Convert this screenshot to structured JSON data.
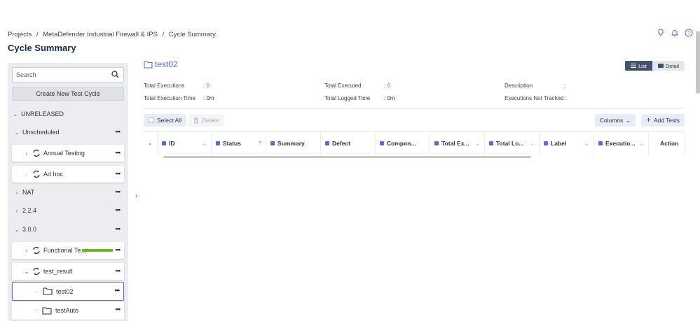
{
  "breadcrumb": [
    "Projects",
    "/",
    "MetaDefender Industrial Firewall & IPS",
    "/",
    "Cycle Summary"
  ],
  "page_title": "Cycle Summary",
  "sidebar": {
    "search_placeholder": "Search",
    "new_cycle_label": "Create New Test Cycle",
    "items": [
      {
        "label": "UNRELEASED"
      },
      {
        "label": "Unscheduled"
      },
      {
        "label": "Annual Testing"
      },
      {
        "label": "Ad hoc"
      },
      {
        "label": "NAT"
      },
      {
        "label": "2.2.4"
      },
      {
        "label": "3.0.0"
      },
      {
        "label": "Functional Te..."
      },
      {
        "label": "test_result"
      },
      {
        "label": "test02"
      },
      {
        "label": "testAuto"
      }
    ]
  },
  "main": {
    "title": "test02",
    "view_list": "List",
    "view_detail": "Detail",
    "stats": {
      "total_executions_label": "Total Executions",
      "total_executions_value": ": 0",
      "total_execution_time_label": "Total Execution Time",
      "total_execution_time_value": ": 0m",
      "total_executed_label": "Total Executed",
      "total_executed_value": ": 0",
      "total_logged_time_label": "Total Logged Time",
      "total_logged_time_value": ": 0m",
      "description_label": "Description",
      "description_value": ":",
      "not_tracked_label": "Executions Not Tracked :"
    },
    "toolbar": {
      "select_all": "Select All",
      "delete": "Delete",
      "columns": "Columns",
      "add_tests": "Add Tests"
    },
    "columns": [
      "-",
      "ID",
      "Status",
      "Summary",
      "Defect",
      "Compon...",
      "Total Ex...",
      "Total Lo...",
      "Label",
      "Executio...",
      "Action"
    ]
  },
  "colors": {
    "accent": "#4c6edb",
    "progress": "#6bb81c",
    "list_active": "#42526e"
  }
}
